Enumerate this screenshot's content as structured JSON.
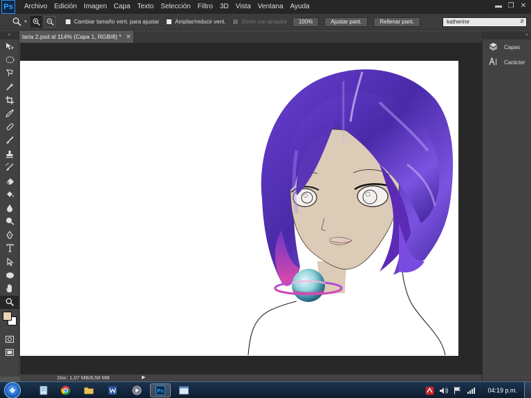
{
  "app": {
    "logo": "Ps"
  },
  "menu": [
    "Archivo",
    "Edición",
    "Imagen",
    "Capa",
    "Texto",
    "Selección",
    "Filtro",
    "3D",
    "Vista",
    "Ventana",
    "Ayuda"
  ],
  "options": {
    "tool_icon": "zoom-icon",
    "resize_windows_label": "Cambiar tamaño vent. para ajustar",
    "zoom_all_windows_label": "Ampliar/reducir vent.",
    "scrubby_zoom_label": "Zoom con arrastre",
    "percent_button": "100%",
    "fit_screen_button": "Ajustar pant.",
    "fill_screen_button": "Rellenar pant.",
    "workspace": "katherine"
  },
  "document": {
    "tab_title": "taria 2.psd al 114% (Capa 1, RGB/8) *",
    "status": "Doc: 1,07 MB/8,58 MB"
  },
  "panels": [
    {
      "label": "Capas",
      "icon": "layers-icon"
    },
    {
      "label": "Carácter",
      "icon": "character-icon"
    }
  ],
  "colors": {
    "foreground": "#e8d4b5",
    "background": "#ffffff",
    "hair": "#5b2bb5",
    "skin": "#dccbb6"
  },
  "taskbar": {
    "clock": "04:19 p.m."
  }
}
